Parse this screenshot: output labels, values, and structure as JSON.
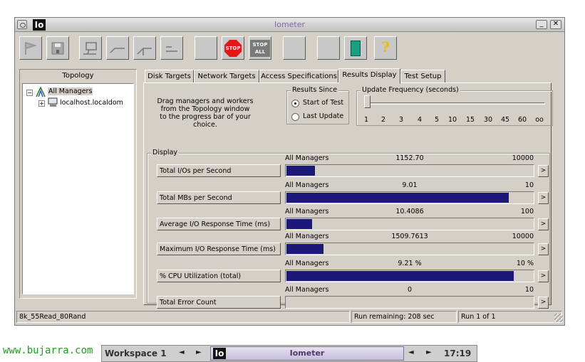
{
  "window": {
    "title": "Iometer",
    "app_icon_text": "Io",
    "minimize_glyph": "_",
    "close_glyph": "✕"
  },
  "toolbar": {
    "buttons": [
      {
        "name": "start-flag-icon"
      },
      {
        "name": "save-icon"
      },
      {
        "name": "new-manager-icon"
      },
      {
        "name": "new-worker-icon"
      },
      {
        "name": "new-network-worker-icon"
      },
      {
        "name": "disconnect-icon"
      },
      {
        "name": "blank-icon"
      },
      {
        "name": "stop-icon",
        "label": "STOP"
      },
      {
        "name": "stop-all-icon",
        "label_top": "STOP",
        "label_bottom": "ALL"
      },
      {
        "name": "blank-icon"
      },
      {
        "name": "blank-icon"
      },
      {
        "name": "exit-icon"
      },
      {
        "name": "help-icon",
        "label": "?"
      }
    ]
  },
  "topology": {
    "header": "Topology",
    "root": "All Managers",
    "child": "localhost.localdom"
  },
  "tabs": [
    "Disk Targets",
    "Network Targets",
    "Access Specifications",
    "Results Display",
    "Test Setup"
  ],
  "active_tab": "Results Display",
  "results": {
    "drag_text_1": "Drag managers and workers",
    "drag_text_2": "from the Topology window",
    "drag_text_3": "to the progress bar of your choice.",
    "results_since": {
      "label": "Results Since",
      "option_start": "Start of Test",
      "option_last": "Last Update",
      "selected": "Start of Test"
    },
    "update_frequency": {
      "label": "Update Frequency (seconds)",
      "ticks": [
        "1",
        "2",
        "3",
        "4",
        "5",
        "10",
        "15",
        "30",
        "45",
        "60",
        "oo"
      ],
      "selected_tick": "1"
    },
    "display_label": "Display",
    "rows": [
      {
        "metric": "Total I/Os per Second",
        "manager": "All Managers",
        "value": "1152.70",
        "max": "10000",
        "fill": 0.1153
      },
      {
        "metric": "Total MBs per Second",
        "manager": "All Managers",
        "value": "9.01",
        "max": "10",
        "fill": 0.901
      },
      {
        "metric": "Average I/O Response Time (ms)",
        "manager": "All Managers",
        "value": "10.4086",
        "max": "100",
        "fill": 0.104
      },
      {
        "metric": "Maximum I/O Response Time (ms)",
        "manager": "All Managers",
        "value": "1509.7613",
        "max": "10000",
        "fill": 0.151
      },
      {
        "metric": "% CPU Utilization (total)",
        "manager": "All Managers",
        "value": "9.21 %",
        "max": "10 %",
        "fill": 0.921
      },
      {
        "metric": "Total Error Count",
        "manager": "All Managers",
        "value": "0",
        "max": "10",
        "fill": 0
      }
    ],
    "row_button_glyph": ">"
  },
  "status": {
    "config_name": "8k_55Read_80Rand",
    "run_remaining": "Run remaining: 208 sec",
    "run_count": "Run 1 of 1"
  },
  "watermark": "www.bujarra.com",
  "taskbar": {
    "workspace": "Workspace 1",
    "task_icon_text": "Io",
    "task_title": "Iometer",
    "clock": "17:19",
    "prev_glyph": "◄",
    "next_glyph": "►"
  },
  "colors": {
    "bar_fill": "#1c1878",
    "title_text": "#806aa0",
    "watermark": "#1aa01a"
  }
}
